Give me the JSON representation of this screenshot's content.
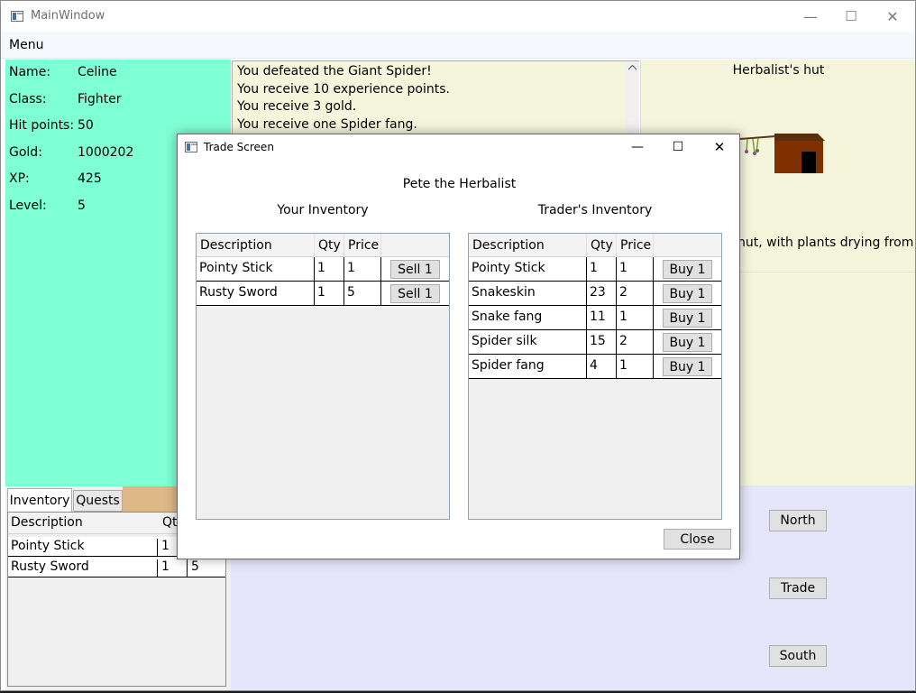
{
  "main_window": {
    "title": "MainWindow",
    "menu": "Menu",
    "controls": {
      "minimize": "—",
      "maximize": "☐",
      "close": "✕"
    }
  },
  "player": {
    "labels": [
      "Name:",
      "Class:",
      "Hit points:",
      "Gold:",
      "XP:",
      "Level:"
    ],
    "values": [
      "Celine",
      "Fighter",
      "50",
      "1000202",
      "425",
      "5"
    ]
  },
  "messages": [
    "You defeated the Giant Spider!",
    "You receive 10 experience points.",
    "You receive 3 gold.",
    "You receive one Spider fang."
  ],
  "location": {
    "name": "Herbalist's hut",
    "description": "hut, with plants drying from"
  },
  "inventory_tabs": {
    "tabs": [
      "Inventory",
      "Quests"
    ],
    "headers": [
      "Description",
      "Qt"
    ],
    "rows": [
      [
        "Pointy Stick",
        "1",
        ""
      ],
      [
        "Rusty Sword",
        "1",
        "5"
      ]
    ]
  },
  "actions": {
    "north": "North",
    "trade": "Trade",
    "south": "South"
  },
  "trade": {
    "title": "Trade Screen",
    "controls": {
      "minimize": "—",
      "maximize": "☐",
      "close": "✕"
    },
    "trader_name": "Pete the Herbalist",
    "your_inventory_title": "Your Inventory",
    "trader_inventory_title": "Trader's Inventory",
    "headers": [
      "Description",
      "Qty",
      "Price"
    ],
    "your_items": [
      {
        "description": "Pointy Stick",
        "qty": "1",
        "price": "1",
        "button": "Sell 1"
      },
      {
        "description": "Rusty Sword",
        "qty": "1",
        "price": "5",
        "button": "Sell 1"
      }
    ],
    "trader_items": [
      {
        "description": "Pointy Stick",
        "qty": "1",
        "price": "1",
        "button": "Buy 1"
      },
      {
        "description": "Snakeskin",
        "qty": "23",
        "price": "2",
        "button": "Buy 1"
      },
      {
        "description": "Snake fang",
        "qty": "11",
        "price": "1",
        "button": "Buy 1"
      },
      {
        "description": "Spider silk",
        "qty": "15",
        "price": "2",
        "button": "Buy 1"
      },
      {
        "description": "Spider fang",
        "qty": "4",
        "price": "1",
        "button": "Buy 1"
      }
    ],
    "close_label": "Close"
  },
  "colors": {
    "stats_bg": "#7fffd4",
    "messages_bg": "#f5f5dc",
    "actions_bg": "#e6e6fa",
    "quests_tab_strip": "#deb887"
  }
}
